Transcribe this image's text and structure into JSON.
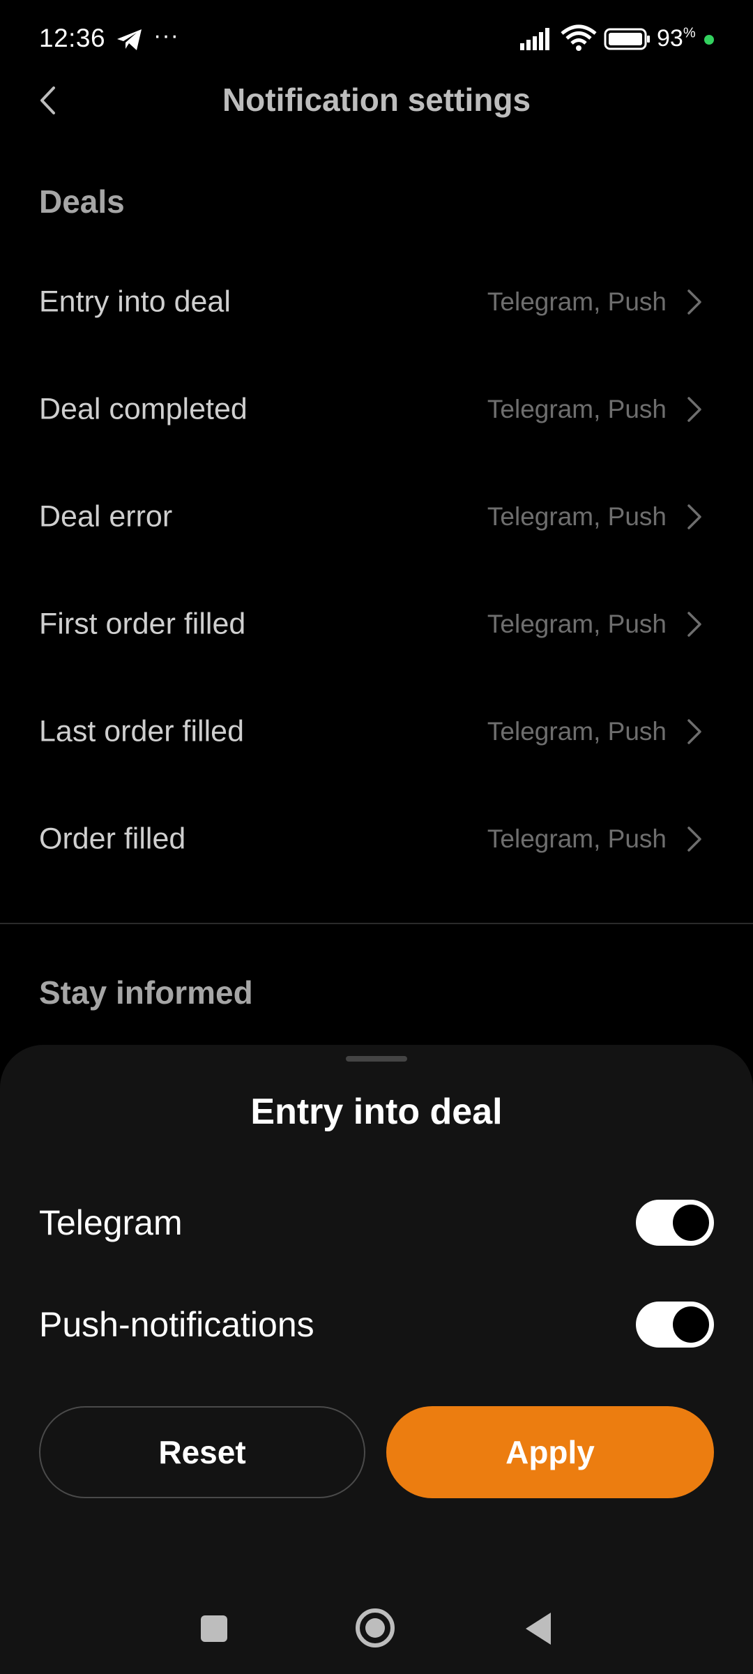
{
  "status_bar": {
    "time": "12:36",
    "more": "···",
    "battery": "93",
    "battery_unit": "%",
    "icons": [
      "telegram-icon",
      "signal-icon",
      "wifi-icon",
      "battery-icon"
    ]
  },
  "header": {
    "title": "Notification settings",
    "back_icon": "chevron-left-icon"
  },
  "sections": {
    "deals_title": "Deals",
    "stay_informed_title": "Stay informed"
  },
  "deals": [
    {
      "label": "Entry into deal",
      "value": "Telegram, Push"
    },
    {
      "label": "Deal completed",
      "value": "Telegram, Push"
    },
    {
      "label": "Deal error",
      "value": "Telegram, Push"
    },
    {
      "label": "First order filled",
      "value": "Telegram, Push"
    },
    {
      "label": "Last order filled",
      "value": "Telegram, Push"
    },
    {
      "label": "Order filled",
      "value": "Telegram, Push"
    }
  ],
  "sheet": {
    "title": "Entry into deal",
    "toggles": [
      {
        "label": "Telegram",
        "on": true
      },
      {
        "label": "Push-notifications",
        "on": true
      }
    ],
    "reset_label": "Reset",
    "apply_label": "Apply"
  },
  "colors": {
    "accent": "#ec7d10",
    "background": "#000000",
    "sheet_background": "#131313"
  }
}
